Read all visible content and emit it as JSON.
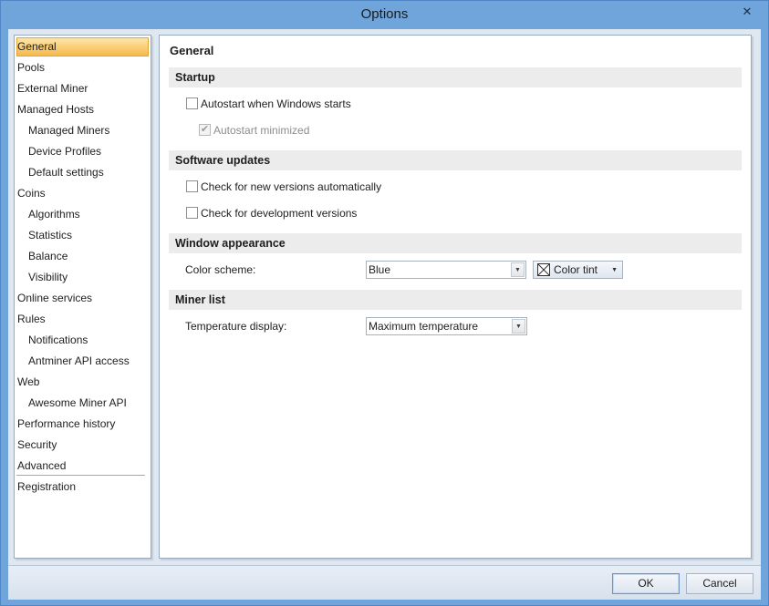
{
  "window": {
    "title": "Options",
    "close_glyph": "✕"
  },
  "nav": {
    "items": [
      {
        "label": "General",
        "sub": false,
        "selected": true
      },
      {
        "label": "Pools",
        "sub": false
      },
      {
        "label": "External Miner",
        "sub": false
      },
      {
        "label": "Managed Hosts",
        "sub": false
      },
      {
        "label": "Managed Miners",
        "sub": true
      },
      {
        "label": "Device Profiles",
        "sub": true
      },
      {
        "label": "Default settings",
        "sub": true
      },
      {
        "label": "Coins",
        "sub": false
      },
      {
        "label": "Algorithms",
        "sub": true
      },
      {
        "label": "Statistics",
        "sub": true
      },
      {
        "label": "Balance",
        "sub": true
      },
      {
        "label": "Visibility",
        "sub": true
      },
      {
        "label": "Online services",
        "sub": false
      },
      {
        "label": "Rules",
        "sub": false
      },
      {
        "label": "Notifications",
        "sub": true
      },
      {
        "label": "Antminer API access",
        "sub": true
      },
      {
        "label": "Web",
        "sub": false
      },
      {
        "label": "Awesome Miner API",
        "sub": true
      },
      {
        "label": "Performance history",
        "sub": false
      },
      {
        "label": "Security",
        "sub": false
      },
      {
        "label": "Advanced",
        "sub": false
      },
      {
        "label": "Registration",
        "sub": false
      }
    ]
  },
  "page": {
    "title": "General",
    "startup": {
      "header": "Startup",
      "autostart_label": "Autostart when Windows starts",
      "autostart_checked": false,
      "minimized_label": "Autostart minimized",
      "minimized_checked": true
    },
    "updates": {
      "header": "Software updates",
      "check_new_label": "Check for new versions automatically",
      "check_dev_label": "Check for development versions"
    },
    "appearance": {
      "header": "Window appearance",
      "color_scheme_label": "Color scheme:",
      "color_scheme_value": "Blue",
      "color_tint_label": "Color tint"
    },
    "miner_list": {
      "header": "Miner list",
      "temperature_label": "Temperature display:",
      "temperature_value": "Maximum temperature"
    }
  },
  "footer": {
    "ok_label": "OK",
    "cancel_label": "Cancel"
  },
  "colors": {
    "titlebar": "#6fa5db",
    "selection": "#f6b94c",
    "client": "#dfe7f1"
  }
}
